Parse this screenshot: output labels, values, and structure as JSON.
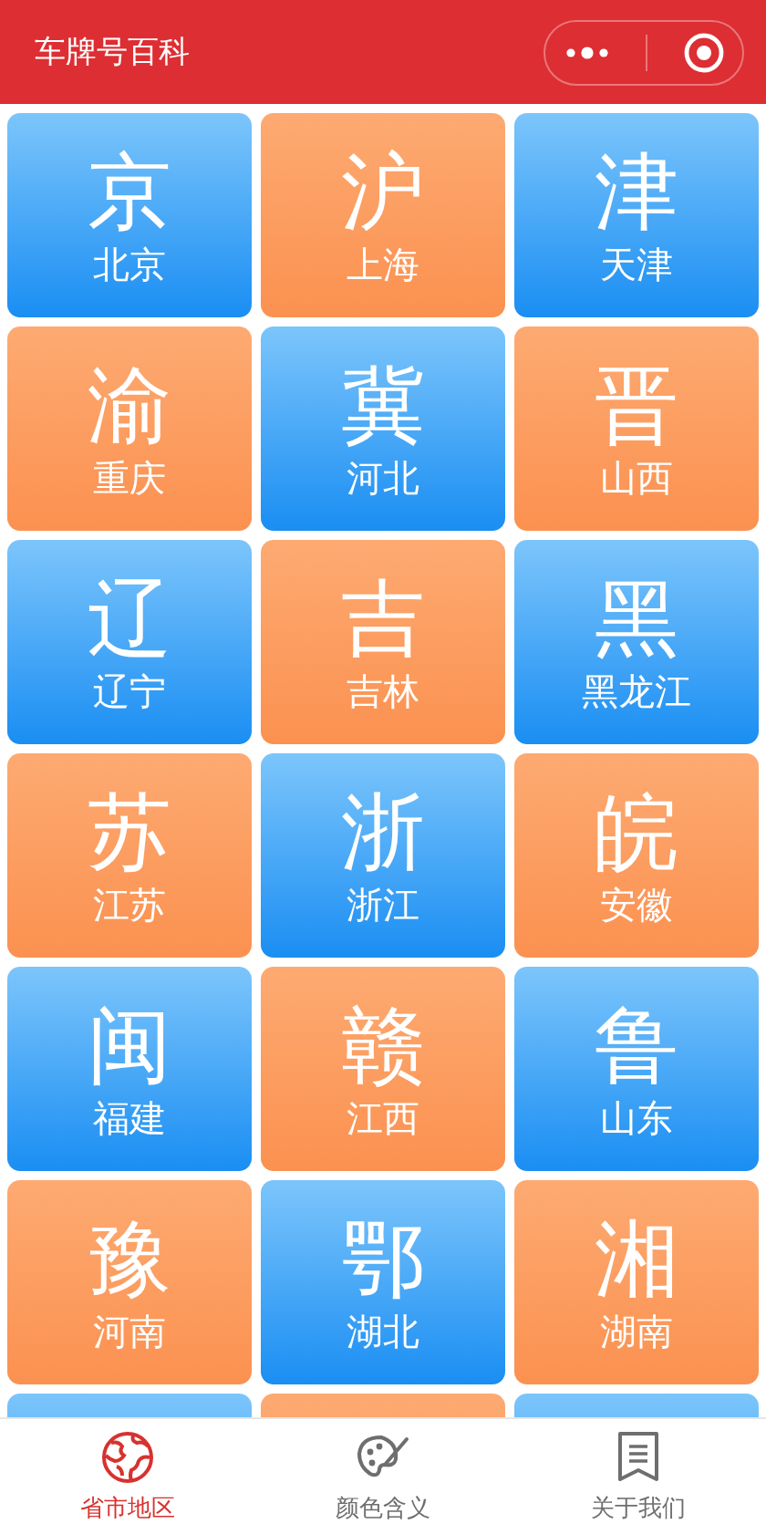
{
  "header": {
    "title": "车牌号百科"
  },
  "plates": [
    {
      "abbr": "京",
      "name": "北京",
      "kind": "blue"
    },
    {
      "abbr": "沪",
      "name": "上海",
      "kind": "orange"
    },
    {
      "abbr": "津",
      "name": "天津",
      "kind": "blue"
    },
    {
      "abbr": "渝",
      "name": "重庆",
      "kind": "orange"
    },
    {
      "abbr": "冀",
      "name": "河北",
      "kind": "blue"
    },
    {
      "abbr": "晋",
      "name": "山西",
      "kind": "orange"
    },
    {
      "abbr": "辽",
      "name": "辽宁",
      "kind": "blue"
    },
    {
      "abbr": "吉",
      "name": "吉林",
      "kind": "orange"
    },
    {
      "abbr": "黑",
      "name": "黑龙江",
      "kind": "blue"
    },
    {
      "abbr": "苏",
      "name": "江苏",
      "kind": "orange"
    },
    {
      "abbr": "浙",
      "name": "浙江",
      "kind": "blue"
    },
    {
      "abbr": "皖",
      "name": "安徽",
      "kind": "orange"
    },
    {
      "abbr": "闽",
      "name": "福建",
      "kind": "blue"
    },
    {
      "abbr": "赣",
      "name": "江西",
      "kind": "orange"
    },
    {
      "abbr": "鲁",
      "name": "山东",
      "kind": "blue"
    },
    {
      "abbr": "豫",
      "name": "河南",
      "kind": "orange"
    },
    {
      "abbr": "鄂",
      "name": "湖北",
      "kind": "blue"
    },
    {
      "abbr": "湘",
      "name": "湖南",
      "kind": "orange"
    },
    {
      "kind": "blue"
    },
    {
      "kind": "orange"
    },
    {
      "kind": "blue"
    }
  ],
  "tabbar": [
    {
      "label": "省市地区",
      "kind": "globe",
      "selected": true
    },
    {
      "label": "颜色含义",
      "kind": "palette",
      "selected": false
    },
    {
      "label": "关于我们",
      "kind": "bookmark",
      "selected": false
    }
  ]
}
